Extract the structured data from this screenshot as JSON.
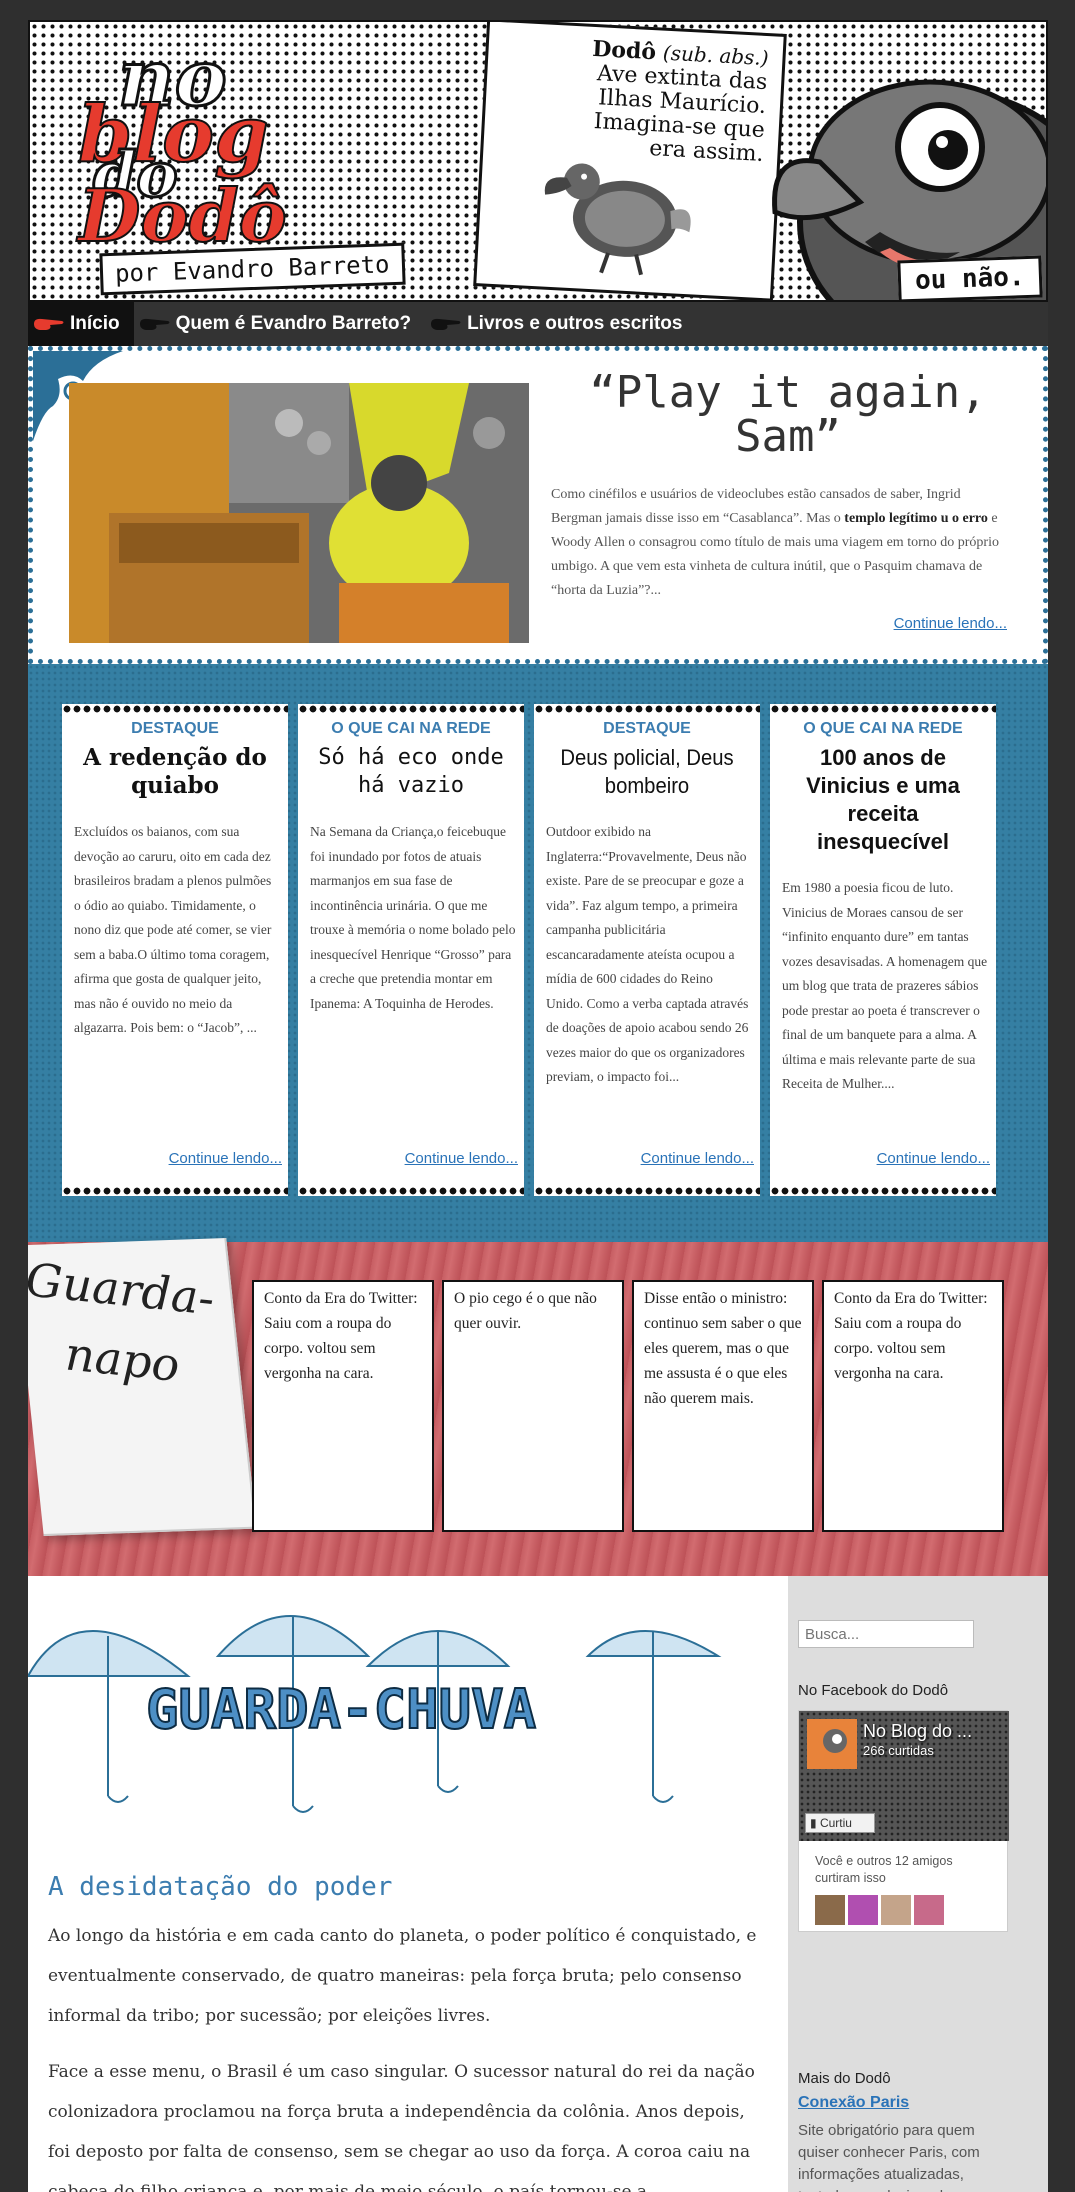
{
  "header": {
    "logo_no": "no",
    "logo_blog": "blog",
    "logo_do": "do",
    "logo_dodo": "Dodô",
    "byline": "por Evandro Barreto",
    "definition_word": "Dodô",
    "definition_class": "(sub. abs.)",
    "definition_lines": [
      "Ave extinta das",
      "Ilhas Maurício.",
      "Imagina-se que",
      "era assim."
    ],
    "ou_nao": "ou não."
  },
  "nav": {
    "items": [
      {
        "label": "Início"
      },
      {
        "label": "Quem é Evandro Barreto?"
      },
      {
        "label": "Livros e outros escritos"
      }
    ]
  },
  "featured": {
    "title": "“Play it again, Sam”",
    "excerpt_before": "Como cinéfilos e usuários de videoclubes estão cansados de saber, Ingrid Bergman jamais disse isso em “Casablanca”. Mas o ",
    "excerpt_bold": "templo legítimo u o erro",
    "excerpt_after": " e Woody Allen o consagrou como título de mais uma viagem em torno do próprio umbigo. A que vem esta vinheta de cultura inútil, que o Pasquim chamava de “horta da Luzia”?...",
    "continue": "Continue lendo..."
  },
  "cards": [
    {
      "kicker": "DESTAQUE",
      "title": "A redenção do quiabo",
      "body": "Excluídos os baianos, com sua devoção ao caruru, oito  em cada dez brasileiros bradam a plenos pulmões o ódio ao quiabo. Timidamente, o nono diz que pode até comer, se vier sem a baba.O último toma coragem, afirma que gosta de qualquer jeito,  mas não é ouvido no meio da algazarra. Pois bem:  o “Jacob”, ...",
      "continue": "Continue lendo..."
    },
    {
      "kicker": "O QUE CAI NA REDE",
      "title": "Só há eco onde há vazio",
      "body": "Na Semana da Criança,o feicebuque foi inundado por fotos de atuais marmanjos em sua fase de incontinência urinária. O que me trouxe à memória o nome bolado pelo inesquecível Henrique “Grosso” para a creche que pretendia montar em Ipanema: A Toquinha de Herodes.",
      "continue": "Continue lendo..."
    },
    {
      "kicker": "DESTAQUE",
      "title": "Deus policial, Deus bombeiro",
      "body": "Outdoor exibido na Inglaterra:“Provavelmente, Deus não existe. Pare de se preocupar e goze a vida”. Faz algum tempo, a primeira campanha publicitária escancaradamente ateísta ocupou a mídia de 600 cidades do Reino Unido. Como a verba captada através de doações de apoio acabou sendo 26 vezes maior do que os organizadores previam, o impacto foi...",
      "continue": "Continue lendo..."
    },
    {
      "kicker": "O QUE CAI NA REDE",
      "title": "100 anos de Vinicius e uma receita inesquecível",
      "body": "Em 1980 a poesia ficou de luto. Vinicius de Moraes cansou de ser “infinito enquanto dure” em tantas vozes desavisadas. A homenagem que um blog que trata de prazeres sábios pode prestar ao poeta é transcrever o final de um banquete para a alma. A última e mais relevante parte de sua Receita de Mulher....",
      "continue": "Continue lendo..."
    }
  ],
  "napkin": {
    "word_1": "Guarda-",
    "word_2": "napo",
    "notes": [
      "Conto da Era do Twitter: Saiu com a roupa do corpo. voltou sem vergonha na cara.",
      "O pio cego é o que não quer ouvir.",
      "Disse então o ministro:  continuo sem saber o que eles querem, mas o que me assusta é o  que eles não querem mais.",
      "Conto da Era do Twitter: Saiu com a roupa do corpo. voltou sem vergonha na cara."
    ]
  },
  "umbrella": {
    "banner": "GUARDA-CHUVA"
  },
  "post": {
    "title": "A desidatação do poder",
    "p1": "Ao longo da história e em cada canto do planeta, o poder político é conquistado, e eventualmente conservado, de quatro maneiras: pela força bruta; pelo consenso informal da tribo; por sucessão; por eleições livres.",
    "p2": "Face a esse menu, o Brasil é um caso singular. O sucessor natural do rei da nação colonizadora proclamou na força bruta a independência da colônia.  Anos depois, foi deposto por falta de consenso, sem se chegar ao uso da força. A coroa caiu na cabeça do filho criança e, por mais de meio século, o país tornou-se a"
  },
  "sidebar": {
    "search_placeholder": "Busca...",
    "facebook_heading": "No Facebook do Dodô",
    "fb_page_name": "No Blog do ...",
    "fb_likes": "266 curtidas",
    "fb_like_button": "Curtiu",
    "fb_friends_text": "Você e outros 12 amigos curtiram isso",
    "more_heading": "Mais do Dodô",
    "more_link": "Conexão Paris",
    "more_text": "Site obrigatório para quem quiser conhecer Paris, com informações atualizadas, testadas e selecionadas."
  },
  "colors": {
    "accent_blue": "#3c7db0",
    "logo_red": "#e63b2e",
    "band_blue": "#357fa3",
    "napkin_red": "#c75e63"
  }
}
